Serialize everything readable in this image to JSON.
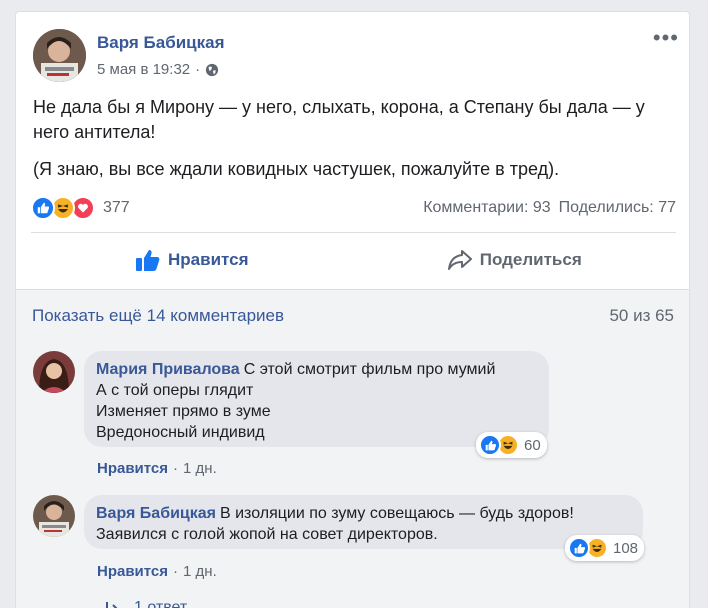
{
  "post": {
    "author": "Варя Бабицкая",
    "date": "5 мая в 19:32",
    "privacy_icon": "globe-icon",
    "more_label": "•••",
    "text_1": "Не дала бы я Мирону — у него, слыхать, корона, а Степану бы дала — у него антитела!",
    "text_2": "(Я знаю, вы все ждали ковидных частушек, пожалуйте в тред).",
    "reactions_count": "377",
    "comments_count": "Комментарии: 93",
    "shares_count": "Поделились: 77"
  },
  "actions": {
    "like_label": "Нравится",
    "share_label": "Поделиться"
  },
  "comments_section": {
    "show_more": "Показать ещё 14 комментариев",
    "pager": "50 из 65"
  },
  "comments": [
    {
      "author": "Мария Привалова",
      "lines": [
        "С этой смотрит фильм про мумий",
        "А с той оперы глядит",
        "Изменяет прямо в зуме",
        "Вредоносный индивид"
      ],
      "reactions": "60",
      "like_label": "Нравится",
      "sep": "·",
      "time": "1 дн."
    },
    {
      "author": "Варя Бабицкая",
      "lines": [
        "В изоляции по зуму совещаюсь — будь здоров!",
        "Заявился с голой жопой на совет директоров."
      ],
      "reactions": "108",
      "like_label": "Нравится",
      "sep": "·",
      "time": "1 дн.",
      "replies": "1 ответ"
    }
  ],
  "colors": {
    "link": "#385898",
    "like_blue": "#1877f2",
    "haha_yellow": "#f7b125",
    "love_red": "#f33e58"
  }
}
